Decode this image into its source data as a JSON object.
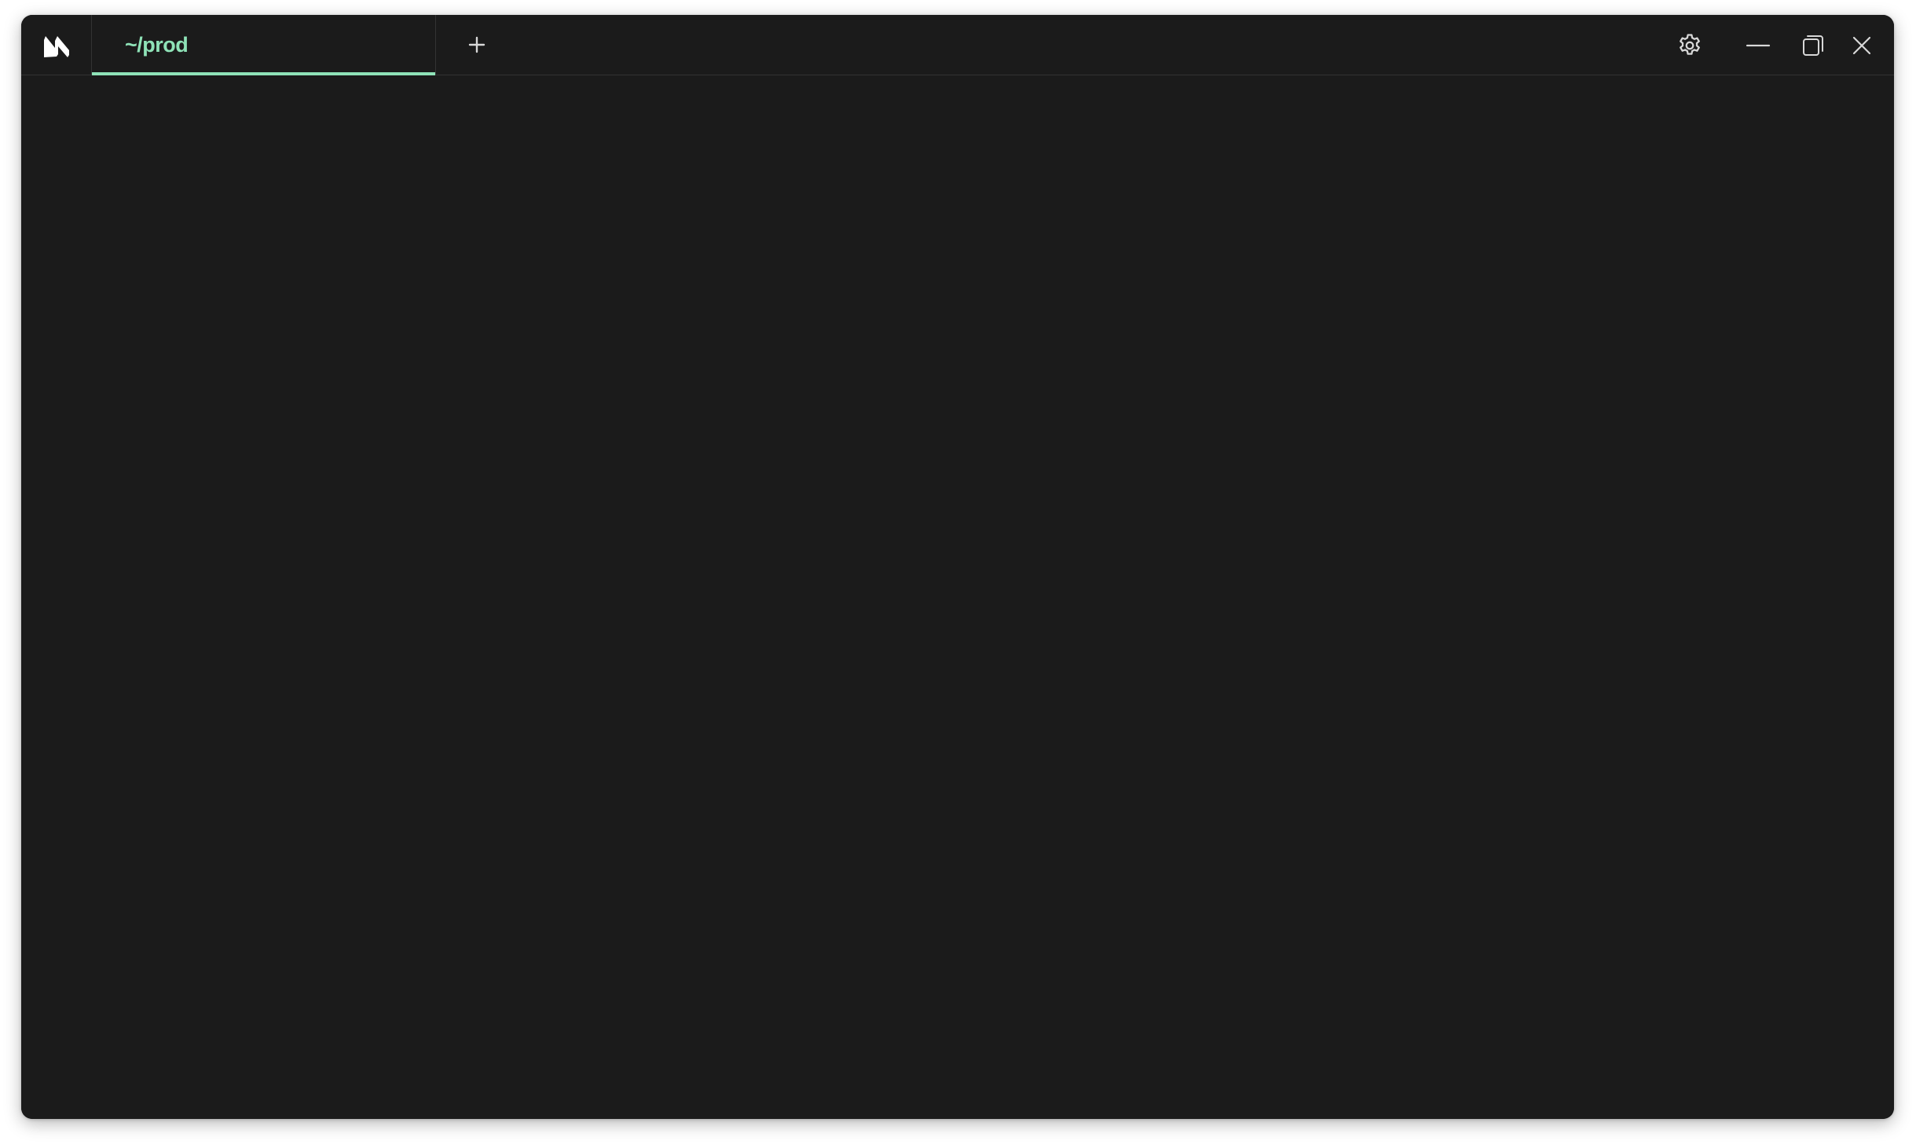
{
  "window": {
    "background": "#1b1b1b",
    "accent": "#8fe3b8"
  },
  "titlebar": {
    "logo_icon": "app-logo-icon",
    "tabs": [
      {
        "label": "~/prod",
        "active": true
      }
    ],
    "new_tab_icon": "plus-icon",
    "controls": {
      "settings_icon": "gear-icon",
      "minimize_icon": "minimize-icon",
      "maximize_icon": "restore-icon",
      "close_icon": "close-icon"
    }
  }
}
